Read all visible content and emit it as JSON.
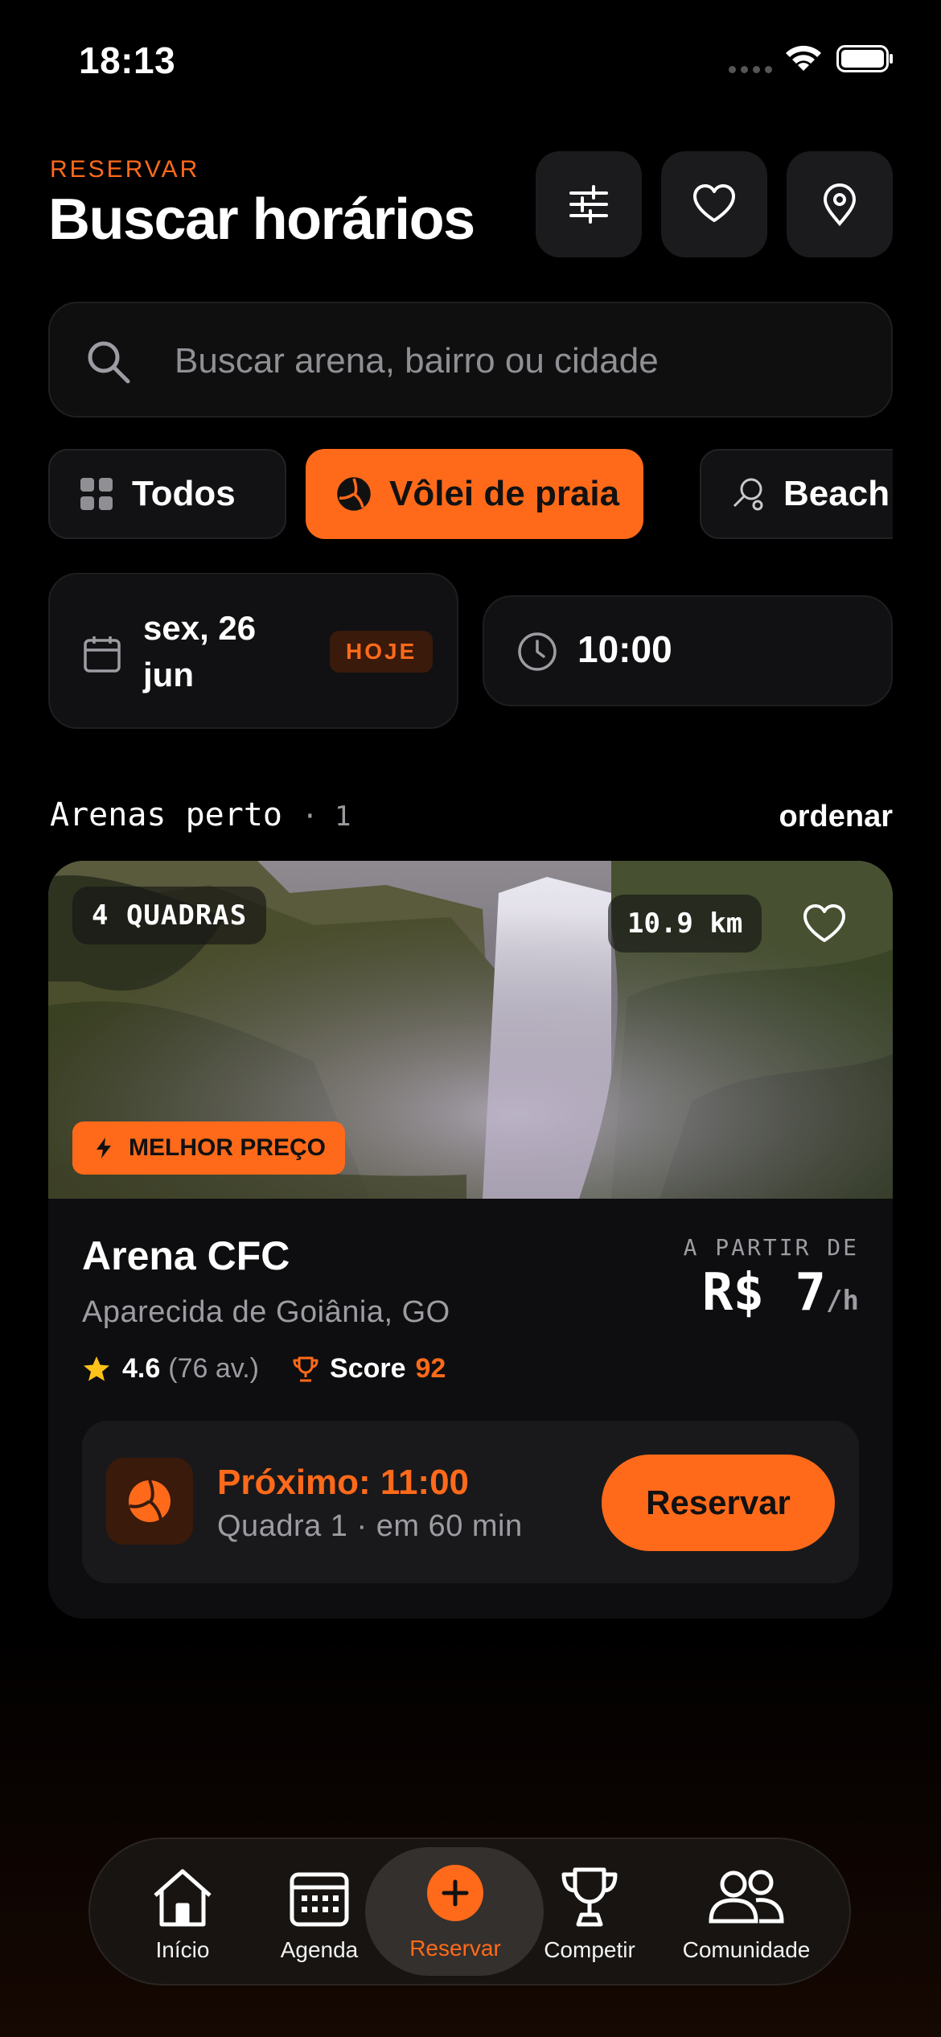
{
  "status_bar": {
    "time": "18:13"
  },
  "header": {
    "eyebrow": "RESERVAR",
    "title": "Buscar horários",
    "icons": [
      "sliders-icon",
      "heart-icon",
      "location-pin-icon"
    ]
  },
  "search": {
    "placeholder": "Buscar arena, bairro ou cidade",
    "value": ""
  },
  "sports": [
    {
      "label": "Todos",
      "icon": "grid-icon",
      "active": false
    },
    {
      "label": "Vôlei de praia",
      "icon": "volleyball-icon",
      "active": true
    },
    {
      "label": "Beach",
      "icon": "racket-icon",
      "active": false
    }
  ],
  "date": {
    "label": "sex, 26 jun",
    "badge": "HOJE"
  },
  "time": {
    "label": "10:00"
  },
  "section": {
    "title": "Arenas perto",
    "count": "· 1",
    "sort_label": "ordenar"
  },
  "arena": {
    "courts_badge": "4 QUADRAS",
    "distance": "10.9 km",
    "price_badge": "MELHOR PREÇO",
    "name": "Arena CFC",
    "city": "Aparecida de Goiânia, GO",
    "rating": "4.6",
    "reviews": "(76 av.)",
    "score_label": "Score",
    "score_value": "92",
    "price_caption": "A PARTIR DE",
    "price": "R$ 7",
    "price_unit": "/h",
    "next_time": "Próximo: 11:00",
    "next_detail": "Quadra 1 · em 60 min",
    "reserve_label": "Reservar"
  },
  "tabs": [
    {
      "label": "Início",
      "icon": "home-icon",
      "active": false
    },
    {
      "label": "Agenda",
      "icon": "calendar-icon",
      "active": false
    },
    {
      "label": "Reservar",
      "icon": "plus-icon",
      "active": true
    },
    {
      "label": "Competir",
      "icon": "trophy-icon",
      "active": false
    },
    {
      "label": "Comunidade",
      "icon": "users-icon",
      "active": false
    }
  ],
  "colors": {
    "accent": "#ff6a1a",
    "background": "#000000",
    "surface": "#111113"
  }
}
